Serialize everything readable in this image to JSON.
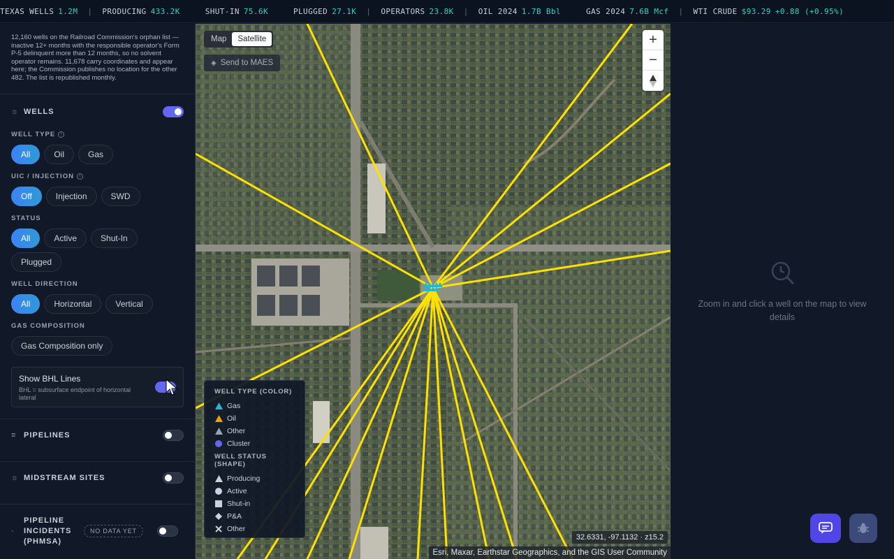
{
  "ticker": [
    {
      "label": "TEXAS WELLS",
      "value": "1.2M"
    },
    {
      "label": "PRODUCING",
      "value": "433.2K"
    },
    {
      "label": "SHUT-IN",
      "value": "75.6K"
    },
    {
      "label": "PLUGGED",
      "value": "27.1K"
    },
    {
      "label": "OPERATORS",
      "value": "23.8K"
    },
    {
      "label": "OIL 2024",
      "value": "1.7B Bbl"
    },
    {
      "label": "GAS 2024",
      "value": "7.6B Mcf"
    },
    {
      "label": "WTI CRUDE",
      "value": "$93.29",
      "change": "+0.88 (+0.95%)"
    }
  ],
  "sidebar": {
    "intro": "12,160 wells on the Railroad Commission's orphan list — inactive 12+ months with the responsible operator's Form P-5 delinquent more than 12 months, so no solvent operator remains. 11,678 carry coordinates and appear here; the Commission publishes no location for the other 482. The list is republished monthly.",
    "wells": {
      "title": "WELLS",
      "enabled": true,
      "well_type": {
        "label": "WELL TYPE",
        "options": [
          "All",
          "Oil",
          "Gas"
        ],
        "selected": "All"
      },
      "uic": {
        "label": "UIC / INJECTION",
        "options": [
          "Off",
          "Injection",
          "SWD"
        ],
        "selected": "Off"
      },
      "status": {
        "label": "STATUS",
        "options": [
          "All",
          "Active",
          "Shut-In",
          "Plugged"
        ],
        "selected": "All"
      },
      "direction": {
        "label": "WELL DIRECTION",
        "options": [
          "All",
          "Horizontal",
          "Vertical"
        ],
        "selected": "All"
      },
      "gas_composition": {
        "label": "GAS COMPOSITION",
        "option": "Gas Composition only"
      },
      "bhl": {
        "title": "Show BHL Lines",
        "subtitle": "BHL = subsurface endpoint of horizontal lateral",
        "enabled": true
      }
    },
    "pipelines": {
      "title": "PIPELINES",
      "enabled": false
    },
    "midstream": {
      "title": "MIDSTREAM SITES",
      "enabled": false
    },
    "incidents": {
      "title": "PIPELINE INCIDENTS (PHMSA)",
      "badge": "NO DATA YET",
      "enabled": false
    }
  },
  "map": {
    "modes": [
      "Map",
      "Satellite"
    ],
    "selected_mode": "Satellite",
    "send_label": "Send to MAES",
    "zoom_in": "+",
    "zoom_out": "−",
    "legend": {
      "type_title": "WELL TYPE (COLOR)",
      "types": [
        {
          "label": "Gas",
          "color": "#22b8cf"
        },
        {
          "label": "Oil",
          "color": "#f59e0b"
        },
        {
          "label": "Other",
          "color": "#9aa3b2"
        },
        {
          "label": "Cluster",
          "color": "#6366f1"
        }
      ],
      "status_title": "WELL STATUS (SHAPE)",
      "statuses": [
        {
          "label": "Producing",
          "shape": "triangle"
        },
        {
          "label": "Active",
          "shape": "circle"
        },
        {
          "label": "Shut-in",
          "shape": "square"
        },
        {
          "label": "P&A",
          "shape": "diamond"
        },
        {
          "label": "Other",
          "shape": "x"
        }
      ]
    },
    "coords": "32.6331, -97.1132 · z15.2",
    "attribution": "Esri, Maxar, Earthstar Geographics, and the GIS User Community",
    "bhl_color": "#ffe100"
  },
  "detail": {
    "empty_text": "Zoom in and click a well on the map to view details"
  }
}
